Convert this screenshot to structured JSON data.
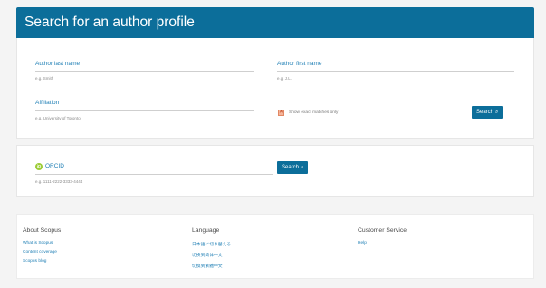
{
  "header": {
    "title": "Search for an author profile"
  },
  "form": {
    "last_name": {
      "label": "Author last name",
      "hint": "e.g. Smith"
    },
    "first_name": {
      "label": "Author first name",
      "hint": "e.g. J.L."
    },
    "affiliation": {
      "label": "Affiliation",
      "hint": "e.g. University of Toronto"
    },
    "exact_match": {
      "label": "Show exact matches only",
      "checked": true
    },
    "search_button": {
      "label": "Search",
      "icon": "search-icon"
    }
  },
  "orcid": {
    "label": "ORCID",
    "hint": "e.g. 1111-2222-3333-4444",
    "icon": "orcid-icon",
    "search_button": {
      "label": "Search",
      "icon": "search-icon"
    }
  },
  "footer": {
    "about": {
      "heading": "About Scopus",
      "links": [
        "What is Scopus",
        "Content coverage",
        "Scopus blog"
      ]
    },
    "language": {
      "heading": "Language",
      "links": [
        "日本語に切り替える",
        "切换到简体中文",
        "切換到繁體中文"
      ]
    },
    "customer_service": {
      "heading": "Customer Service",
      "links": [
        "Help"
      ]
    }
  },
  "colors": {
    "brand": "#0c6e9a",
    "link": "#1f7fb5",
    "orcid": "#9ccc37",
    "checkbox": "#f5b59a"
  }
}
